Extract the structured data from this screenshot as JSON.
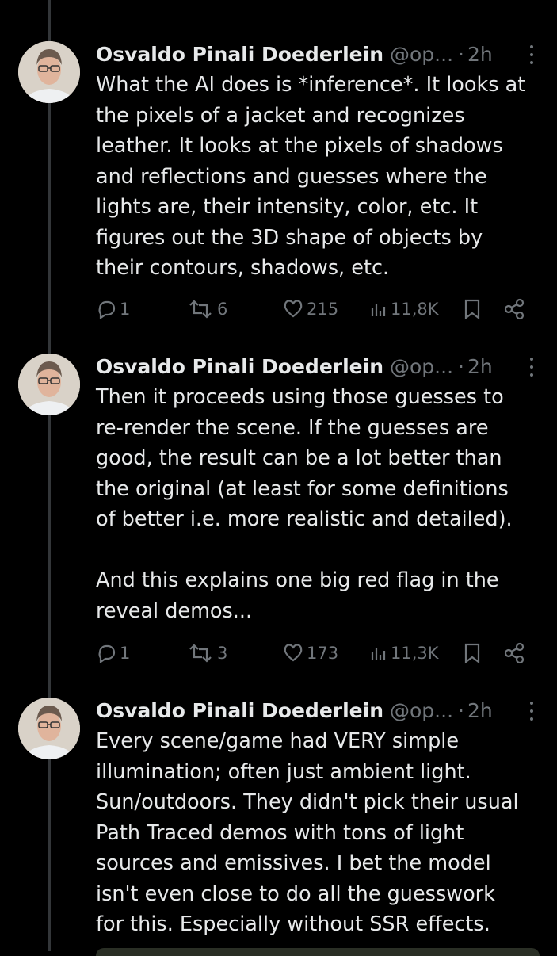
{
  "tweets": [
    {
      "name": "Osvaldo Pinali Doederlein",
      "handle": "@op...",
      "time": "2h",
      "text": "What the AI does is *inference*. It looks at\nthe pixels of a jacket and recognizes\nleather. It looks at the pixels of shadows\nand reflections and guesses where the\nlights are, their intensity, color, etc. It\nfigures out the 3D shape of objects by\ntheir contours, shadows, etc.",
      "replies": "1",
      "reposts": "6",
      "likes": "215",
      "views": "11,8K"
    },
    {
      "name": "Osvaldo Pinali Doederlein",
      "handle": "@op...",
      "time": "2h",
      "text": "Then it proceeds using those guesses to\nre-render the scene. If the guesses are\ngood, the result can be a lot better than\nthe original (at least for some definitions\nof better i.e. more realistic and detailed).\n\nAnd this explains one big red flag in the\nreveal demos...",
      "replies": "1",
      "reposts": "3",
      "likes": "173",
      "views": "11,3K"
    },
    {
      "name": "Osvaldo Pinali Doederlein",
      "handle": "@op...",
      "time": "2h",
      "text": "Every scene/game had VERY simple\nillumination; often just ambient light.\nSun/outdoors. They didn't pick their usual\nPath Traced demos with tons of light\nsources and emissives. I bet the model\nisn't even close to do all the guesswork\nfor this. Especially without SSR effects."
    }
  ],
  "icons": {
    "reply": "reply-icon",
    "repost": "repost-icon",
    "like": "heart-icon",
    "views": "views-icon",
    "bookmark": "bookmark-icon",
    "share": "share-icon",
    "more": "more-icon"
  },
  "colors": {
    "background": "#000000",
    "text": "#e7e9ea",
    "muted": "#71767b",
    "thread_line": "#333639"
  }
}
